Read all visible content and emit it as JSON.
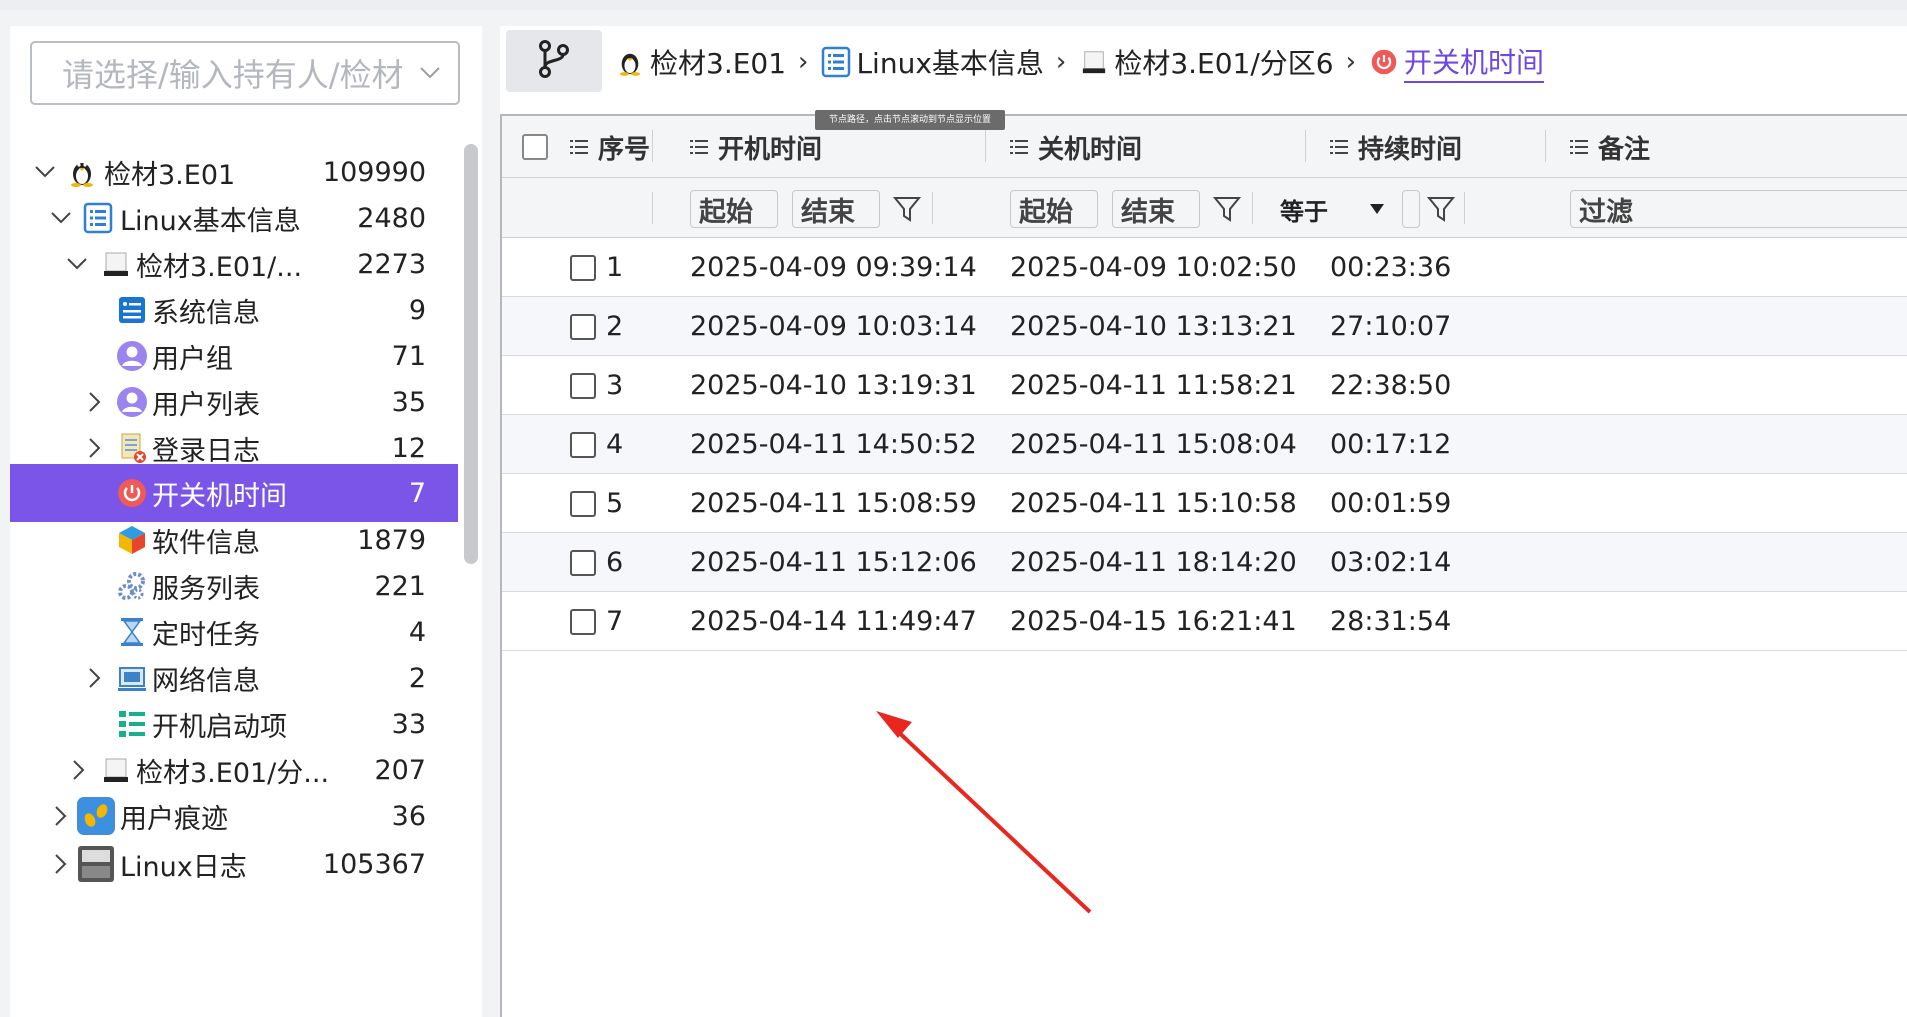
{
  "selector": {
    "placeholder": "请选择/输入持有人/检材"
  },
  "tree": [
    {
      "label": "检材3.E01",
      "count": "109990",
      "icon": "linux-penguin-icon",
      "expanded": true
    },
    {
      "label": "Linux基本信息",
      "count": "2480",
      "icon": "list-document-icon",
      "expanded": true
    },
    {
      "label": "检材3.E01/...",
      "count": "2273",
      "icon": "disk-icon",
      "expanded": true
    },
    {
      "label": "系统信息",
      "count": "9",
      "icon": "system-info-icon"
    },
    {
      "label": "用户组",
      "count": "71",
      "icon": "user-group-icon"
    },
    {
      "label": "用户列表",
      "count": "35",
      "icon": "user-list-icon",
      "collapsed": true
    },
    {
      "label": "登录日志",
      "count": "12",
      "icon": "login-log-icon",
      "collapsed": true
    },
    {
      "label": "开关机时间",
      "count": "7",
      "icon": "power-icon",
      "selected": true
    },
    {
      "label": "软件信息",
      "count": "1879",
      "icon": "software-cube-icon"
    },
    {
      "label": "服务列表",
      "count": "221",
      "icon": "service-gears-icon"
    },
    {
      "label": "定时任务",
      "count": "4",
      "icon": "hourglass-icon"
    },
    {
      "label": "网络信息",
      "count": "2",
      "icon": "network-icon",
      "collapsed": true
    },
    {
      "label": "开机启动项",
      "count": "33",
      "icon": "startup-list-icon"
    },
    {
      "label": "检材3.E01/分...",
      "count": "207",
      "icon": "disk-icon",
      "collapsed": true
    },
    {
      "label": "用户痕迹",
      "count": "36",
      "icon": "footprints-icon",
      "collapsed": true
    },
    {
      "label": "Linux日志",
      "count": "105367",
      "icon": "log-icon",
      "collapsed": true
    }
  ],
  "breadcrumb": [
    {
      "label": "检材3.E01",
      "icon": "linux-penguin-icon"
    },
    {
      "label": "Linux基本信息",
      "icon": "list-document-icon"
    },
    {
      "label": "检材3.E01/分区6",
      "icon": "disk-icon"
    },
    {
      "label": "开关机时间",
      "icon": "power-icon"
    }
  ],
  "tooltip": "节点路径，点击节点滚动到节点显示位置",
  "columns": {
    "index": "序号",
    "boot": "开机时间",
    "shutdown": "关机时间",
    "duration": "持续时间",
    "note": "备注"
  },
  "filters": {
    "start": "起始",
    "end": "结束",
    "equals": "等于",
    "filter": "过滤"
  },
  "rows": [
    {
      "index": "1",
      "boot": "2025-04-09 09:39:14",
      "shutdown": "2025-04-09 10:02:50",
      "duration": "00:23:36"
    },
    {
      "index": "2",
      "boot": "2025-04-09 10:03:14",
      "shutdown": "2025-04-10 13:13:21",
      "duration": "27:10:07"
    },
    {
      "index": "3",
      "boot": "2025-04-10 13:19:31",
      "shutdown": "2025-04-11 11:58:21",
      "duration": "22:38:50"
    },
    {
      "index": "4",
      "boot": "2025-04-11 14:50:52",
      "shutdown": "2025-04-11 15:08:04",
      "duration": "00:17:12"
    },
    {
      "index": "5",
      "boot": "2025-04-11 15:08:59",
      "shutdown": "2025-04-11 15:10:58",
      "duration": "00:01:59"
    },
    {
      "index": "6",
      "boot": "2025-04-11 15:12:06",
      "shutdown": "2025-04-11 18:14:20",
      "duration": "03:02:14"
    },
    {
      "index": "7",
      "boot": "2025-04-14 11:49:47",
      "shutdown": "2025-04-15 16:21:41",
      "duration": "28:31:54"
    }
  ],
  "colors": {
    "accent": "#7b55e8",
    "annotation_arrow": "#e8271e",
    "power": "#e84a4a"
  }
}
